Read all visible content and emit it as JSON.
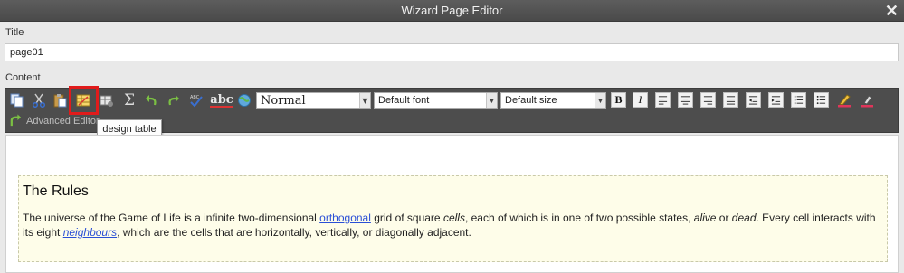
{
  "window": {
    "title": "Wizard Page Editor",
    "close_label": "✕"
  },
  "title_field": {
    "label": "Title",
    "value": "page01"
  },
  "content_label": "Content",
  "toolbar": {
    "style_select": "Normal",
    "font_select": "Default font",
    "size_select": "Default size",
    "bold": "B",
    "italic": "I",
    "spellcheck_label": "abc",
    "sum_symbol": "Σ",
    "advanced_editor": "Advanced Editor"
  },
  "tooltip": "design table",
  "editor": {
    "heading": "The Rules",
    "p1": "The universe of the Game of Life is a infinite two-dimensional ",
    "link1": "orthogonal",
    "p2": " grid of square ",
    "em1": "cells",
    "p3": ", each of which is in one of two possible states, ",
    "em2": "alive",
    "p4": " or ",
    "em3": "dead",
    "p5": ". Every cell interacts with its eight ",
    "link2": "neighbours",
    "p6": ", which are the cells that are horizontally, vertically, or diagonally adjacent."
  },
  "colors": {
    "highlight": "#e01b1b",
    "link": "#2a4fd6",
    "toolbar_bg": "#4d4d4d"
  }
}
